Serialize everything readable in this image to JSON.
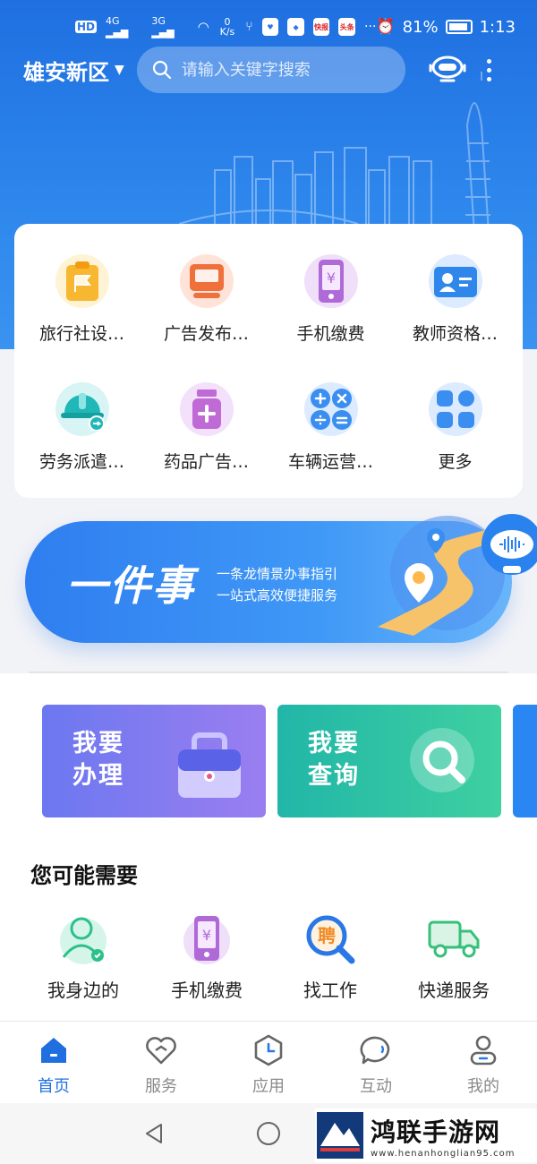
{
  "status_bar": {
    "network": "HD",
    "sig1": "4G",
    "sig2": "3G",
    "speed": "0 K/s",
    "apps": [
      "快报",
      "头条"
    ],
    "dots": "···",
    "battery": "81%",
    "time": "1:13"
  },
  "header": {
    "region": "雄安新区",
    "search_placeholder": "请输入关键字搜索"
  },
  "services": [
    {
      "label": "旅行社设…",
      "icon": "clipboard-flag-icon",
      "color": "#f7b731"
    },
    {
      "label": "广告发布…",
      "icon": "billboard-icon",
      "color": "#f0703c"
    },
    {
      "label": "手机缴费",
      "icon": "phone-payment-icon",
      "color": "#b06ad8"
    },
    {
      "label": "教师资格…",
      "icon": "id-card-icon",
      "color": "#2f86eb"
    },
    {
      "label": "劳务派遣…",
      "icon": "worker-helmet-icon",
      "color": "#1fb7b8"
    },
    {
      "label": "药品广告…",
      "icon": "medicine-bottle-icon",
      "color": "#c06ad6"
    },
    {
      "label": "车辆运营…",
      "icon": "calculator-icon",
      "color": "#3a8ef0"
    },
    {
      "label": "更多",
      "icon": "grid-more-icon",
      "color": "#3a8ef0"
    }
  ],
  "banner": {
    "title": "一件事",
    "line1": "一条龙情景办事指引",
    "line2": "一站式高效便捷服务"
  },
  "quick_actions": [
    {
      "title": "我要办理",
      "icon": "briefcase-icon"
    },
    {
      "title": "我要查询",
      "icon": "magnifier-icon"
    }
  ],
  "section": {
    "title": "您可能需要"
  },
  "needs": [
    {
      "label": "我身边的",
      "icon": "person-location-icon"
    },
    {
      "label": "手机缴费",
      "icon": "phone-payment-icon"
    },
    {
      "label": "找工作",
      "icon": "job-search-icon",
      "badge": "聘"
    },
    {
      "label": "快递服务",
      "icon": "delivery-truck-icon"
    }
  ],
  "tabs": [
    {
      "label": "首页",
      "icon": "home-icon",
      "active": true
    },
    {
      "label": "服务",
      "icon": "heart-hand-icon"
    },
    {
      "label": "应用",
      "icon": "hexagon-clock-icon"
    },
    {
      "label": "互动",
      "icon": "chat-bubble-icon"
    },
    {
      "label": "我的",
      "icon": "user-icon"
    }
  ],
  "watermark": {
    "title": "鸿联手游网",
    "url": "www.henanhonglian95.com"
  },
  "colors": {
    "primary": "#1f6fe0",
    "header_gradient_end": "#3a93f0"
  }
}
